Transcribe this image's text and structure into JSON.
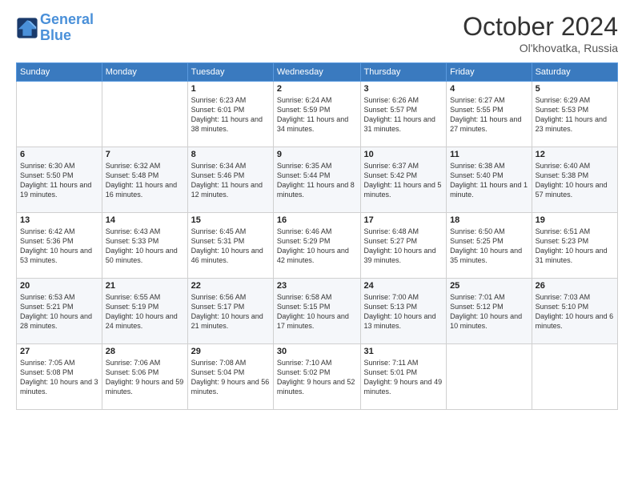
{
  "header": {
    "logo_line1": "General",
    "logo_line2": "Blue",
    "month": "October 2024",
    "location": "Ol'khovatka, Russia"
  },
  "weekdays": [
    "Sunday",
    "Monday",
    "Tuesday",
    "Wednesday",
    "Thursday",
    "Friday",
    "Saturday"
  ],
  "weeks": [
    [
      {
        "day": "",
        "info": ""
      },
      {
        "day": "",
        "info": ""
      },
      {
        "day": "1",
        "info": "Sunrise: 6:23 AM\nSunset: 6:01 PM\nDaylight: 11 hours and 38 minutes."
      },
      {
        "day": "2",
        "info": "Sunrise: 6:24 AM\nSunset: 5:59 PM\nDaylight: 11 hours and 34 minutes."
      },
      {
        "day": "3",
        "info": "Sunrise: 6:26 AM\nSunset: 5:57 PM\nDaylight: 11 hours and 31 minutes."
      },
      {
        "day": "4",
        "info": "Sunrise: 6:27 AM\nSunset: 5:55 PM\nDaylight: 11 hours and 27 minutes."
      },
      {
        "day": "5",
        "info": "Sunrise: 6:29 AM\nSunset: 5:53 PM\nDaylight: 11 hours and 23 minutes."
      }
    ],
    [
      {
        "day": "6",
        "info": "Sunrise: 6:30 AM\nSunset: 5:50 PM\nDaylight: 11 hours and 19 minutes."
      },
      {
        "day": "7",
        "info": "Sunrise: 6:32 AM\nSunset: 5:48 PM\nDaylight: 11 hours and 16 minutes."
      },
      {
        "day": "8",
        "info": "Sunrise: 6:34 AM\nSunset: 5:46 PM\nDaylight: 11 hours and 12 minutes."
      },
      {
        "day": "9",
        "info": "Sunrise: 6:35 AM\nSunset: 5:44 PM\nDaylight: 11 hours and 8 minutes."
      },
      {
        "day": "10",
        "info": "Sunrise: 6:37 AM\nSunset: 5:42 PM\nDaylight: 11 hours and 5 minutes."
      },
      {
        "day": "11",
        "info": "Sunrise: 6:38 AM\nSunset: 5:40 PM\nDaylight: 11 hours and 1 minute."
      },
      {
        "day": "12",
        "info": "Sunrise: 6:40 AM\nSunset: 5:38 PM\nDaylight: 10 hours and 57 minutes."
      }
    ],
    [
      {
        "day": "13",
        "info": "Sunrise: 6:42 AM\nSunset: 5:36 PM\nDaylight: 10 hours and 53 minutes."
      },
      {
        "day": "14",
        "info": "Sunrise: 6:43 AM\nSunset: 5:33 PM\nDaylight: 10 hours and 50 minutes."
      },
      {
        "day": "15",
        "info": "Sunrise: 6:45 AM\nSunset: 5:31 PM\nDaylight: 10 hours and 46 minutes."
      },
      {
        "day": "16",
        "info": "Sunrise: 6:46 AM\nSunset: 5:29 PM\nDaylight: 10 hours and 42 minutes."
      },
      {
        "day": "17",
        "info": "Sunrise: 6:48 AM\nSunset: 5:27 PM\nDaylight: 10 hours and 39 minutes."
      },
      {
        "day": "18",
        "info": "Sunrise: 6:50 AM\nSunset: 5:25 PM\nDaylight: 10 hours and 35 minutes."
      },
      {
        "day": "19",
        "info": "Sunrise: 6:51 AM\nSunset: 5:23 PM\nDaylight: 10 hours and 31 minutes."
      }
    ],
    [
      {
        "day": "20",
        "info": "Sunrise: 6:53 AM\nSunset: 5:21 PM\nDaylight: 10 hours and 28 minutes."
      },
      {
        "day": "21",
        "info": "Sunrise: 6:55 AM\nSunset: 5:19 PM\nDaylight: 10 hours and 24 minutes."
      },
      {
        "day": "22",
        "info": "Sunrise: 6:56 AM\nSunset: 5:17 PM\nDaylight: 10 hours and 21 minutes."
      },
      {
        "day": "23",
        "info": "Sunrise: 6:58 AM\nSunset: 5:15 PM\nDaylight: 10 hours and 17 minutes."
      },
      {
        "day": "24",
        "info": "Sunrise: 7:00 AM\nSunset: 5:13 PM\nDaylight: 10 hours and 13 minutes."
      },
      {
        "day": "25",
        "info": "Sunrise: 7:01 AM\nSunset: 5:12 PM\nDaylight: 10 hours and 10 minutes."
      },
      {
        "day": "26",
        "info": "Sunrise: 7:03 AM\nSunset: 5:10 PM\nDaylight: 10 hours and 6 minutes."
      }
    ],
    [
      {
        "day": "27",
        "info": "Sunrise: 7:05 AM\nSunset: 5:08 PM\nDaylight: 10 hours and 3 minutes."
      },
      {
        "day": "28",
        "info": "Sunrise: 7:06 AM\nSunset: 5:06 PM\nDaylight: 9 hours and 59 minutes."
      },
      {
        "day": "29",
        "info": "Sunrise: 7:08 AM\nSunset: 5:04 PM\nDaylight: 9 hours and 56 minutes."
      },
      {
        "day": "30",
        "info": "Sunrise: 7:10 AM\nSunset: 5:02 PM\nDaylight: 9 hours and 52 minutes."
      },
      {
        "day": "31",
        "info": "Sunrise: 7:11 AM\nSunset: 5:01 PM\nDaylight: 9 hours and 49 minutes."
      },
      {
        "day": "",
        "info": ""
      },
      {
        "day": "",
        "info": ""
      }
    ]
  ]
}
